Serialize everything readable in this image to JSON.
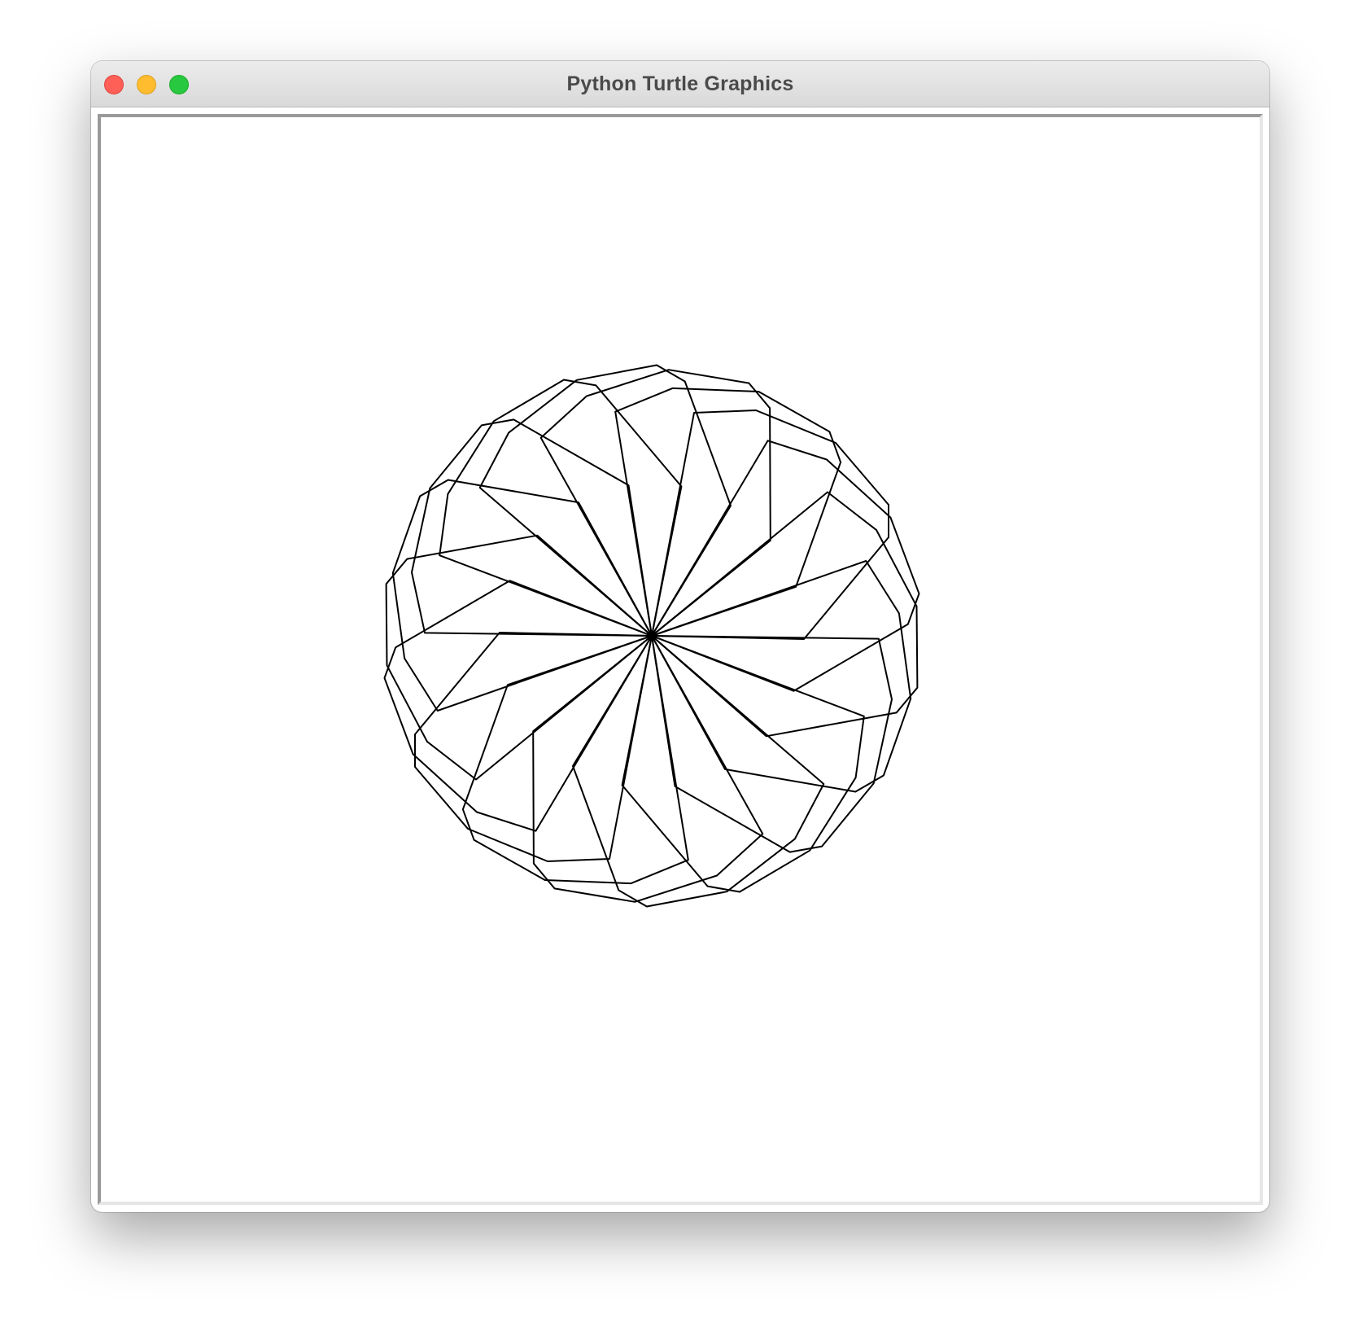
{
  "window": {
    "title": "Python Turtle Graphics"
  },
  "controls": {
    "close_color": "#fe5f57",
    "minimize_color": "#febc2e",
    "zoom_color": "#28c840"
  },
  "canvas": {
    "background": "#ffffff",
    "pen_color": "#000000"
  }
}
